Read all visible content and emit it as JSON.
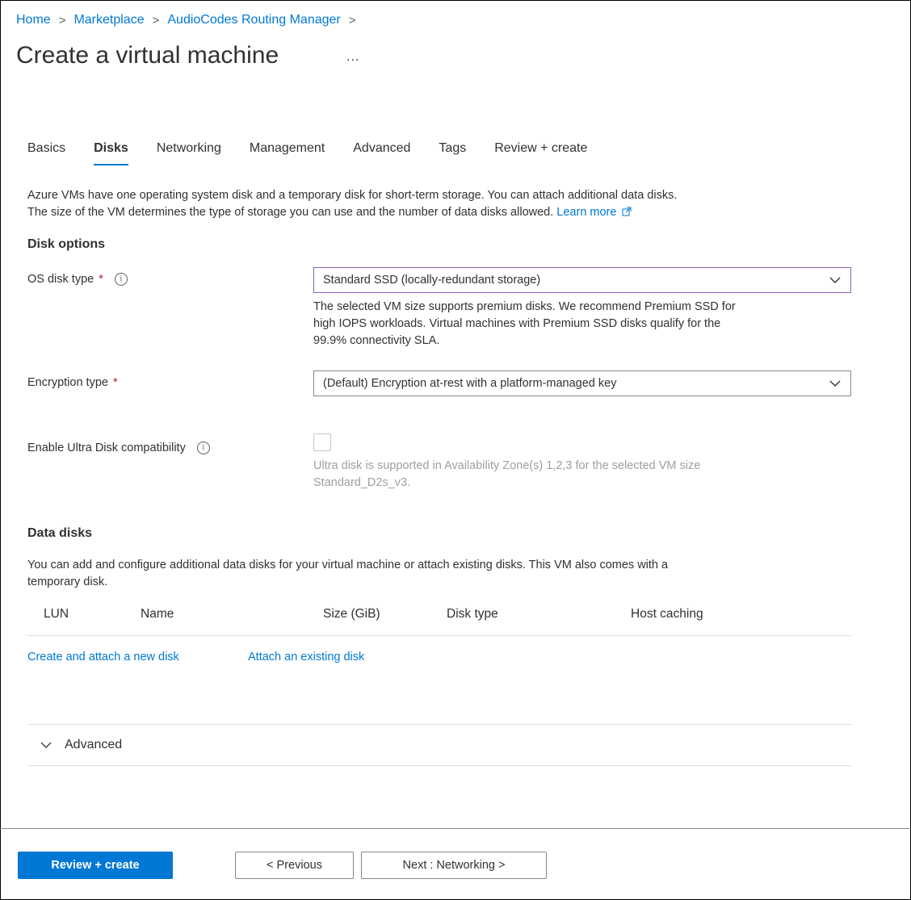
{
  "breadcrumb": {
    "items": [
      "Home",
      "Marketplace",
      "AudioCodes Routing Manager"
    ],
    "separator": ">"
  },
  "page": {
    "title": "Create a virtual machine",
    "more": "..."
  },
  "tabs": [
    "Basics",
    "Disks",
    "Networking",
    "Management",
    "Advanced",
    "Tags",
    "Review + create"
  ],
  "active_tab": "Disks",
  "intro": {
    "line1": "Azure VMs have one operating system disk and a temporary disk for short-term storage. You can attach additional data disks.",
    "line2": "The size of the VM determines the type of storage you can use and the number of data disks allowed.",
    "learn_more": "Learn more"
  },
  "disk_options": {
    "heading": "Disk options",
    "os_disk_type": {
      "label": "OS disk type",
      "required": "*",
      "value": "Standard SSD (locally-redundant storage)",
      "help1": "The selected VM size supports premium disks. We recommend Premium SSD for",
      "help2": "high IOPS workloads. Virtual machines with Premium SSD disks qualify for the",
      "help3": "99.9% connectivity SLA."
    },
    "encryption_type": {
      "label": "Encryption type",
      "required": "*",
      "value": "(Default) Encryption at-rest with a platform-managed key"
    },
    "ultra_disk": {
      "label": "Enable Ultra Disk compatibility",
      "help1": "Ultra disk is supported in Availability Zone(s) 1,2,3 for the selected VM size",
      "help2": "Standard_D2s_v3."
    }
  },
  "data_disks": {
    "heading": "Data disks",
    "desc1": "You can add and configure additional data disks for your virtual machine or attach existing disks. This VM also comes with a",
    "desc2": "temporary disk.",
    "columns": [
      "LUN",
      "Name",
      "Size (GiB)",
      "Disk type",
      "Host caching"
    ],
    "create_link": "Create and attach a new disk",
    "attach_link": "Attach an existing disk"
  },
  "advanced_section": "Advanced",
  "footer": {
    "review_create": "Review + create",
    "previous": "< Previous",
    "next": "Next : Networking >"
  },
  "colors": {
    "accent": "#0078d4",
    "required": "#a4262c",
    "focus_border": "#8764b8"
  }
}
